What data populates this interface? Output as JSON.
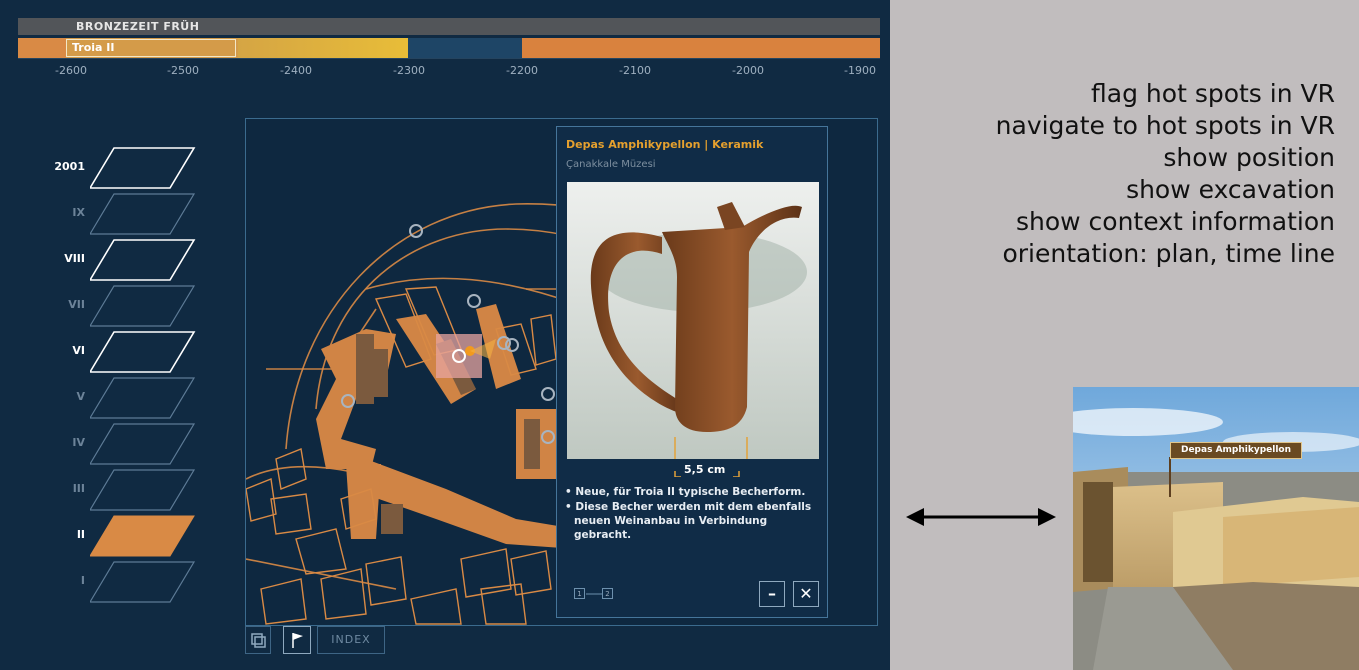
{
  "timeline": {
    "era": "BRONZEZEIT FRÜH",
    "period": "Troia II",
    "ticks": [
      "-2600",
      "-2500",
      "-2400",
      "-2300",
      "-2200",
      "-2100",
      "-2000",
      "-1900"
    ]
  },
  "layers": [
    {
      "label": "2001",
      "active": true,
      "selected": false
    },
    {
      "label": "IX",
      "active": false,
      "selected": false
    },
    {
      "label": "VIII",
      "active": true,
      "selected": false
    },
    {
      "label": "VII",
      "active": false,
      "selected": false
    },
    {
      "label": "VI",
      "active": true,
      "selected": false
    },
    {
      "label": "V",
      "active": false,
      "selected": false
    },
    {
      "label": "IV",
      "active": false,
      "selected": false
    },
    {
      "label": "III",
      "active": false,
      "selected": false
    },
    {
      "label": "II",
      "active": true,
      "selected": true
    },
    {
      "label": "I",
      "active": false,
      "selected": false
    }
  ],
  "popup": {
    "title": "Depas Amphikypellon | Keramik",
    "subtitle": "Çanakkale Müzesi",
    "dimension": "5,5 cm",
    "bullets": [
      "• Neue, für Troia II typische Becherform.",
      "• Diese Becher werden mit dem ebenfalls neuen Weinanbau in Verbindung gebracht."
    ],
    "pages": [
      "1",
      "2"
    ],
    "minimize_label": "–",
    "close_label": "✕"
  },
  "toolbar": {
    "index_label": "INDEX"
  },
  "features": [
    "flag hot spots in VR",
    "navigate to hot spots in VR",
    "show position",
    "show excavation",
    "show context information",
    "orientation: plan, time line"
  ],
  "vr": {
    "label": "Depas Amphikypellon"
  },
  "colors": {
    "panel": "#102a42",
    "accent": "#d98a45",
    "gold": "#e2b23e",
    "highlight": "#e5a02e"
  },
  "icons": {
    "layers_toggle": "layers-icon",
    "flag": "flag-icon",
    "arrow": "double-arrow-icon"
  }
}
